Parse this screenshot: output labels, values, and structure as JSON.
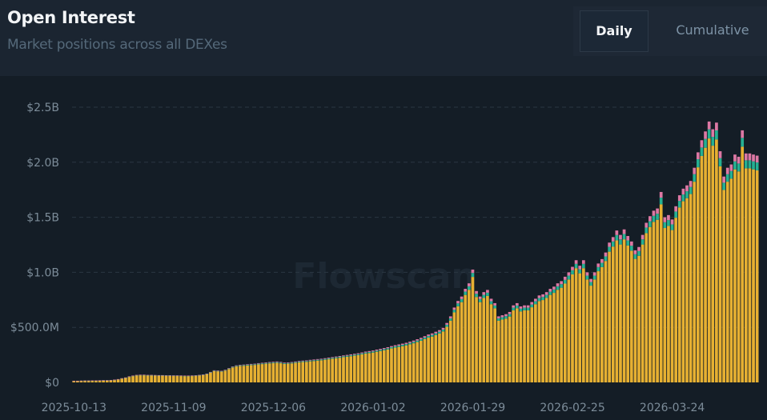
{
  "header": {
    "title": "Open Interest",
    "subtitle": "Market positions across all DEXes",
    "toggle": {
      "daily": "Daily",
      "cumulative": "Cumulative",
      "selected": "Daily"
    }
  },
  "watermark": "Flowscan",
  "chart_data": {
    "type": "bar",
    "stacked": true,
    "unit": "USD millions",
    "start_date": "2025-10-13",
    "x_tick_labels": [
      "2025-10-13",
      "2025-11-09",
      "2025-12-06",
      "2026-01-02",
      "2026-01-29",
      "2026-02-25",
      "2026-03-24"
    ],
    "x_tick_days": [
      0,
      27,
      54,
      81,
      108,
      135,
      162
    ],
    "y_tick_labels": [
      "$0",
      "$500.0M",
      "$1.0B",
      "$1.5B",
      "$2.0B",
      "$2.5B"
    ],
    "y_tick_values": [
      0,
      500,
      1000,
      1500,
      2000,
      2500
    ],
    "ylim": [
      0,
      2500
    ],
    "grid": true,
    "totals": [
      15,
      15,
      16,
      17,
      17,
      18,
      18,
      19,
      20,
      20,
      22,
      25,
      30,
      38,
      45,
      55,
      62,
      68,
      70,
      70,
      68,
      68,
      67,
      66,
      66,
      65,
      65,
      64,
      64,
      63,
      62,
      62,
      63,
      65,
      68,
      72,
      80,
      95,
      110,
      108,
      105,
      115,
      130,
      145,
      155,
      160,
      162,
      165,
      168,
      170,
      175,
      178,
      182,
      185,
      188,
      190,
      186,
      180,
      182,
      185,
      190,
      195,
      198,
      200,
      205,
      208,
      212,
      215,
      220,
      225,
      230,
      235,
      240,
      245,
      250,
      255,
      260,
      265,
      272,
      280,
      285,
      290,
      298,
      305,
      312,
      320,
      330,
      338,
      345,
      352,
      360,
      370,
      380,
      392,
      405,
      420,
      435,
      445,
      460,
      475,
      495,
      540,
      600,
      680,
      740,
      780,
      850,
      900,
      1025,
      830,
      780,
      820,
      840,
      760,
      720,
      600,
      610,
      620,
      640,
      700,
      720,
      690,
      700,
      700,
      730,
      760,
      790,
      800,
      820,
      850,
      870,
      900,
      920,
      960,
      1000,
      1050,
      1110,
      1060,
      1110,
      1000,
      940,
      1000,
      1080,
      1120,
      1180,
      1270,
      1320,
      1380,
      1340,
      1390,
      1330,
      1280,
      1200,
      1230,
      1340,
      1450,
      1510,
      1560,
      1580,
      1730,
      1500,
      1520,
      1480,
      1600,
      1700,
      1760,
      1790,
      1830,
      1950,
      2090,
      2200,
      2280,
      2370,
      2300,
      2360,
      2100,
      1870,
      1950,
      1980,
      2070,
      2050,
      2290,
      2080,
      2080,
      2070,
      2060
    ],
    "segments": [
      {
        "share": 0.935,
        "color": "#e6b032"
      },
      {
        "share": 0.035,
        "color": "#25b092"
      },
      {
        "share": 0.03,
        "color": "#dd78a4"
      }
    ],
    "colors": {
      "grid": "#2a3642",
      "axis_text": "#7c8c99"
    }
  }
}
